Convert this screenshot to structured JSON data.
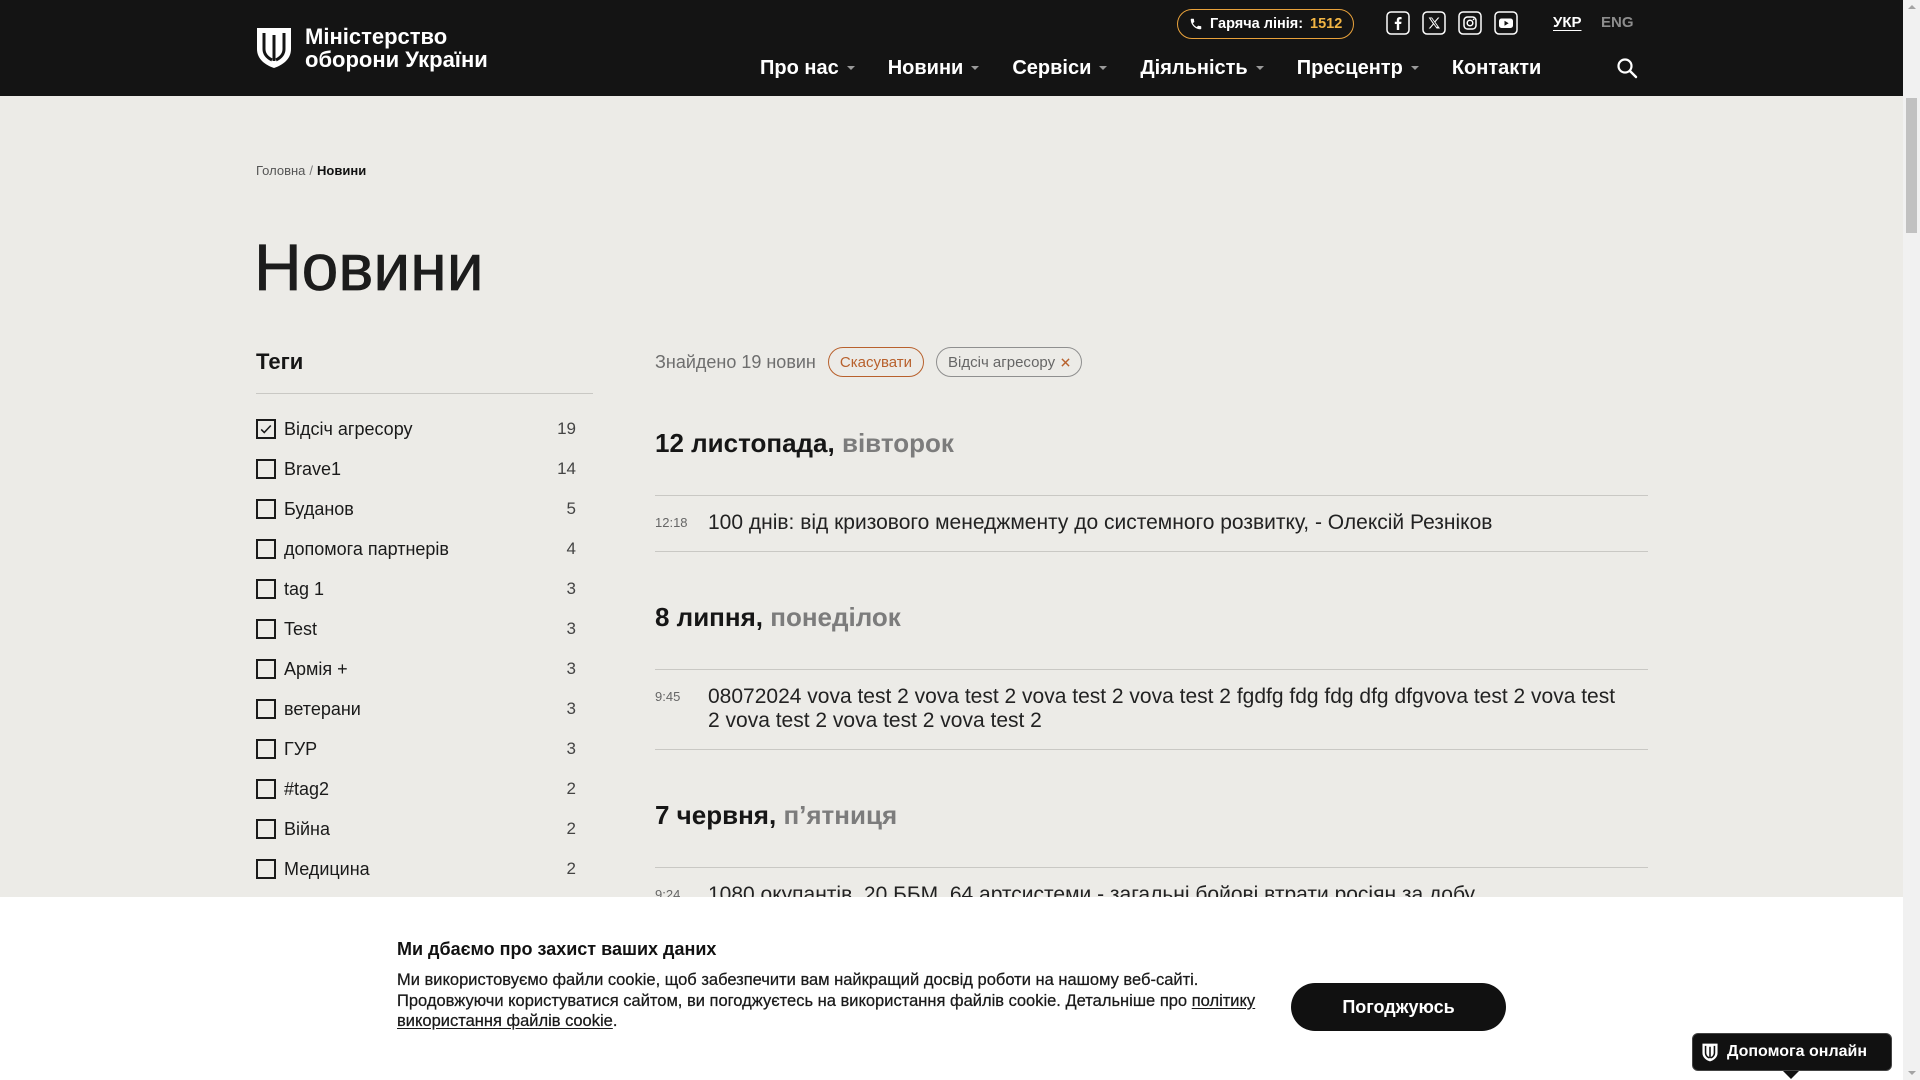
{
  "colors": {
    "header_background": "#141414",
    "page_background": "#ecebe7",
    "hotline_accent": "#e9a23b",
    "reset_accent": "#b8612d"
  },
  "header": {
    "logo_line_1": "Міністерство",
    "logo_line_2": "оборони України",
    "logo_icon": "ministry-emblem-icon",
    "hotline_icon": "phone-icon",
    "hotline_label": "Гаряча лінія:",
    "hotline_number": "1512",
    "social_icons": [
      "facebook-icon",
      "x-icon",
      "instagram-icon",
      "youtube-icon"
    ],
    "languages": [
      "УКР",
      "ENG"
    ],
    "active_language": "УКР",
    "nav": [
      {
        "label": "Про нас",
        "has_dropdown": true
      },
      {
        "label": "Новини",
        "has_dropdown": true
      },
      {
        "label": "Сервіси",
        "has_dropdown": true
      },
      {
        "label": "Діяльність",
        "has_dropdown": true
      },
      {
        "label": "Пресцентр",
        "has_dropdown": true
      },
      {
        "label": "Контакти",
        "has_dropdown": false
      }
    ],
    "search_icon": "search-icon"
  },
  "breadcrumb": {
    "home": "Головна",
    "separator": "/",
    "current": "Новини"
  },
  "page_title": "Новини",
  "sidebar": {
    "title": "Теги",
    "tags": [
      {
        "label": "Відсіч агресору",
        "count": 19,
        "checked": true
      },
      {
        "label": "Brave1",
        "count": 14,
        "checked": false
      },
      {
        "label": "Буданов",
        "count": 5,
        "checked": false
      },
      {
        "label": "допомога партнерів",
        "count": 4,
        "checked": false
      },
      {
        "label": "tag 1",
        "count": 3,
        "checked": false
      },
      {
        "label": "Test",
        "count": 3,
        "checked": false
      },
      {
        "label": "Армія +",
        "count": 3,
        "checked": false
      },
      {
        "label": "ветерани",
        "count": 3,
        "checked": false
      },
      {
        "label": "ГУР",
        "count": 3,
        "checked": false
      },
      {
        "label": "#tag2",
        "count": 2,
        "checked": false
      },
      {
        "label": "Війна",
        "count": 2,
        "checked": false
      },
      {
        "label": "Медицина",
        "count": 2,
        "checked": false
      }
    ]
  },
  "results": {
    "found_text": "Знайдено 19 новин",
    "reset_label": "Скасувати",
    "active_filter": "Відсіч агресору"
  },
  "news_groups": [
    {
      "date": "12 листопада,",
      "weekday": "вівторок",
      "items": [
        {
          "time": "12:18",
          "title": "100 днів: від кризового менеджменту до системного розвитку, - Олексій Резніков"
        }
      ]
    },
    {
      "date": "8 липня,",
      "weekday": "понеділок",
      "items": [
        {
          "time": "9:45",
          "title": "08072024 vova test 2 vova test 2 vova test 2 vova test 2 fgdfg fdg fdg dfg dfgvova test 2 vova test 2 vova test 2 vova test 2 vova test 2"
        }
      ]
    },
    {
      "date": "7 червня,",
      "weekday": "п’ятниця",
      "items": [
        {
          "time": "9:24",
          "title": "1080 окупантів, 20 ББМ, 64 артсистеми - загальні бойові втрати росіян за добу"
        }
      ]
    }
  ],
  "cookie": {
    "title": "Ми дбаємо про захист ваших даних",
    "text_1": "Ми використовуємо файли cookie, щоб забезпечити вам найкращий досвід роботи на нашому веб-сайті.",
    "text_2": "Продовжуючи користуватися сайтом, ви погоджуєтесь на використання файлів cookie. Детальніше про",
    "policy_link": "політику використання файлів cookie",
    "text_end": ".",
    "accept_label": "Погоджуюсь"
  },
  "help_chat": {
    "label": "Допомога онлайн",
    "icon": "ministry-emblem-icon"
  }
}
